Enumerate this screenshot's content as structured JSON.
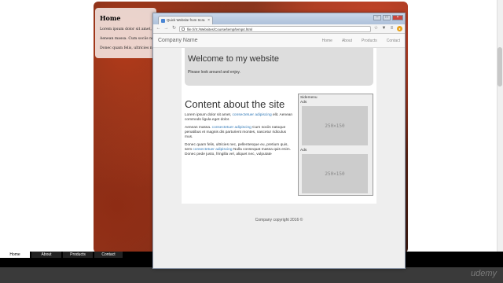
{
  "background_page": {
    "sidebar": {
      "heading": "Home",
      "paragraphs": [
        "Lorem ipsum dolor sit amet, consectetur",
        "Aenean massa. Cum sociis natoque",
        "Donec quam felis, ultricies nec, pellentesque"
      ]
    },
    "nav": [
      "Home",
      "About",
      "Products",
      "Contact"
    ]
  },
  "browser": {
    "tab_title": "Quick Website from Scra",
    "url": "file:///X:/Websites/Course/temp/temp4.html",
    "window_controls": [
      "minimize",
      "maximize",
      "close"
    ]
  },
  "site": {
    "brand": "Company Name",
    "nav": [
      "Home",
      "About",
      "Products",
      "Contact"
    ],
    "jumbotron": {
      "title": "Welcome to my website",
      "text": "Please look around and enjoy."
    },
    "content": {
      "heading": "Content about the site",
      "p1_before": "Lorem ipsum dolor sit amet, ",
      "p1_link": "consectetuer adipiscing",
      "p1_after": " elit. Aenean commodo ligula eget dolor.",
      "p2_before": "Aenean massa. ",
      "p2_link": "consectetuer adipiscing",
      "p2_after": " Cum sociis natoque penatibus et magnis dis parturient montes, nascetur ridiculus mus.",
      "p3_before": "Donec quam felis, ultricies nec, pellentesque eu, pretium quis, sem ",
      "p3_link": "consectetuer adipiscing",
      "p3_after": " Nulla consequat massa quis enim. Donec pede justo, fringilla vel, aliquet nec, vulputate"
    },
    "sidebar": {
      "title": "Sidemenu",
      "ads_label_1": "Ads",
      "ad_1": "250×150",
      "ads_label_2": "Ads",
      "ad_2": "250×150"
    },
    "footer": "Company copyright 2016 ©"
  },
  "watermark": "udemy"
}
